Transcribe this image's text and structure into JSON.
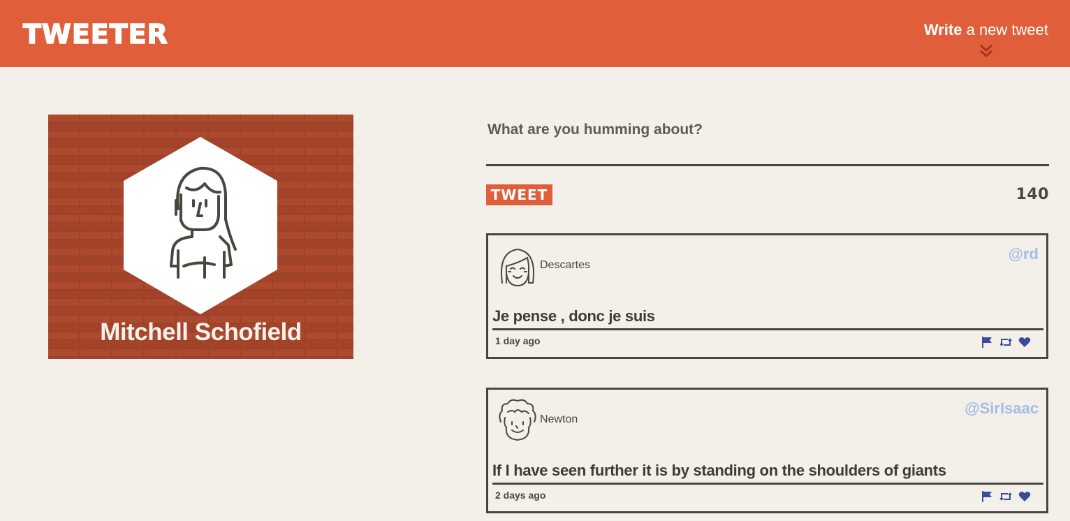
{
  "header": {
    "brand": "TWEETER",
    "compose_toggle": {
      "bold": "Write",
      "rest": "a new tweet"
    },
    "toggle_icon": "double-chevron-down-icon"
  },
  "profile": {
    "name": "Mitchell Schofield",
    "avatar_icon": "woman-avatar-icon",
    "background": "brick-wall-pattern"
  },
  "compose": {
    "placeholder": "What are you humming about?",
    "value": "",
    "submit_label": "TWEET",
    "char_counter": "140"
  },
  "tweets": [
    {
      "display_name": "Descartes",
      "handle": "@rd",
      "content": "Je pense , donc je suis",
      "time": "1 day ago",
      "avatar_icon": "smiling-girl-avatar-icon",
      "actions": [
        "flag-icon",
        "retweet-icon",
        "heart-icon"
      ]
    },
    {
      "display_name": "Newton",
      "handle": "@SirIsaac",
      "content": "If I have seen further it is by standing on the shoulders of giants",
      "time": "2 days ago",
      "avatar_icon": "curly-hair-avatar-icon",
      "actions": [
        "flag-icon",
        "retweet-icon",
        "heart-icon"
      ]
    }
  ],
  "colors": {
    "accent": "#e05e39",
    "background": "#f3efe9",
    "text": "#4a453f",
    "handle": "#a3bde4",
    "action_icons": "#3a4aa0",
    "brick": "#a8462a"
  }
}
